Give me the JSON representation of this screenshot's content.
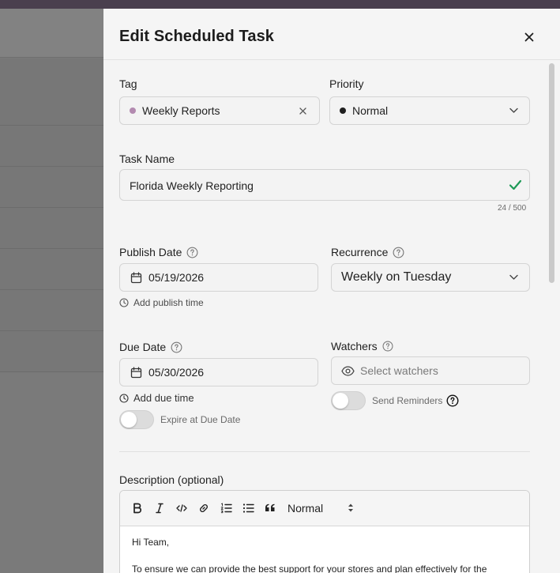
{
  "modal": {
    "title": "Edit Scheduled Task",
    "close_icon": "close-icon"
  },
  "tag": {
    "label": "Tag",
    "value": "Weekly Reports",
    "dot_color": "#b38ab0",
    "clear_icon": "close-icon"
  },
  "priority": {
    "label": "Priority",
    "value": "Normal",
    "dot_color": "#1f1f1f",
    "chevron_icon": "chevron-down-icon"
  },
  "task_name": {
    "label": "Task Name",
    "value": "Florida Weekly Reporting",
    "valid_icon": "check-icon",
    "valid_color": "#1e9a57",
    "counter": "24 / 500"
  },
  "publish_date": {
    "label": "Publish Date",
    "value": "05/19/2026",
    "add_time": "Add publish time",
    "help_icon": "question-circle-icon",
    "calendar_icon": "calendar-icon",
    "clock_icon": "clock-icon"
  },
  "recurrence": {
    "label": "Recurrence",
    "value": "Weekly on Tuesday",
    "help_icon": "question-circle-icon",
    "chevron_icon": "chevron-down-icon"
  },
  "due_date": {
    "label": "Due Date",
    "value": "05/30/2026",
    "add_time": "Add due time",
    "expire_label": "Expire at Due Date",
    "expire_enabled": false
  },
  "watchers": {
    "label": "Watchers",
    "placeholder": "Select watchers",
    "eye_icon": "eye-icon",
    "reminders_label": "Send Reminders",
    "reminders_enabled": false
  },
  "description": {
    "label": "Description (optional)",
    "toolbar": {
      "buttons": [
        "bold-icon",
        "italic-icon",
        "code-icon",
        "link-icon",
        "ordered-list-icon",
        "bullet-list-icon",
        "quote-icon"
      ],
      "format_value": "Normal"
    },
    "paragraphs": [
      "Hi Team,",
      "To ensure we can provide the best support for your stores and plan effectively for the"
    ]
  }
}
